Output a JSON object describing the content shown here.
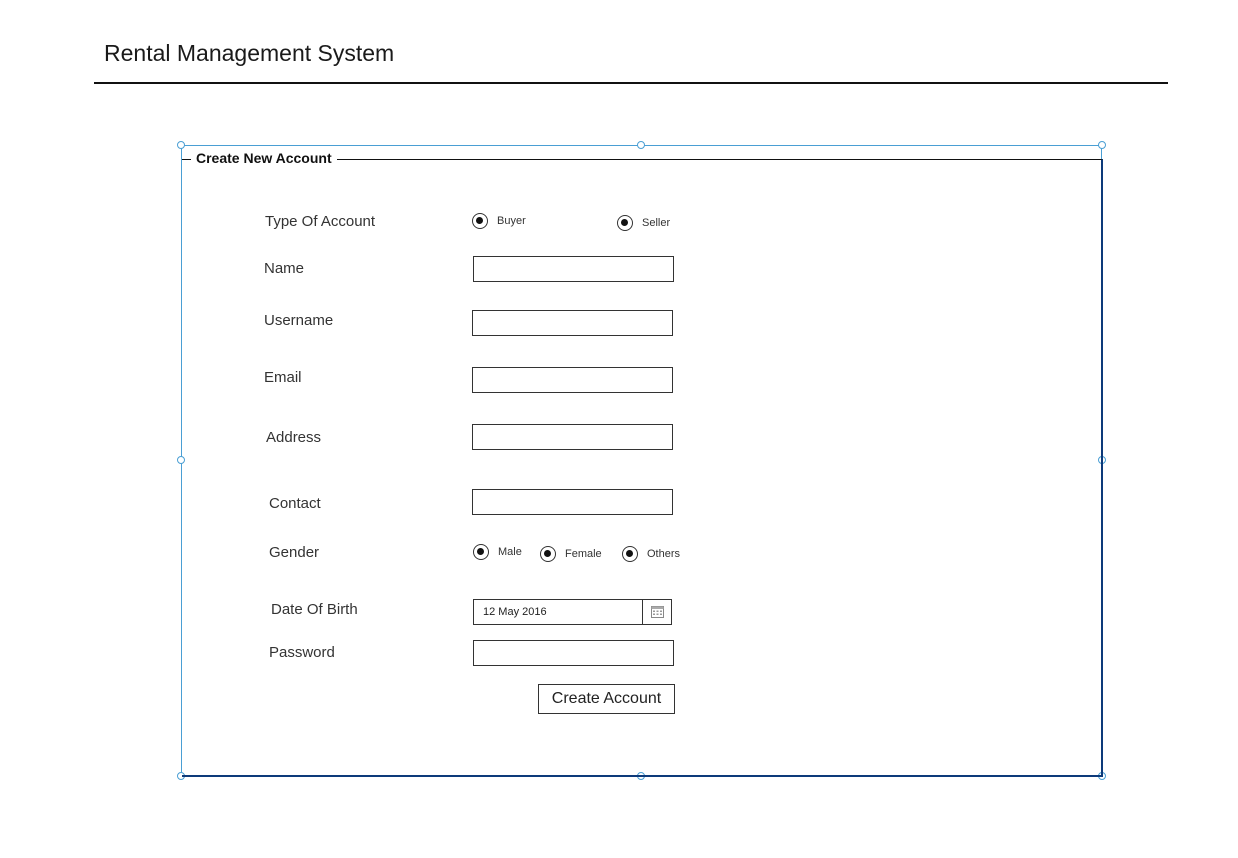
{
  "app": {
    "title": "Rental Management System"
  },
  "form": {
    "legend": "Create New Account",
    "account_type": {
      "label": "Type Of Account",
      "options": [
        "Buyer",
        "Seller"
      ]
    },
    "name": {
      "label": "Name",
      "value": ""
    },
    "username": {
      "label": "Username",
      "value": ""
    },
    "email": {
      "label": "Email",
      "value": ""
    },
    "address": {
      "label": "Address",
      "value": ""
    },
    "contact": {
      "label": "Contact",
      "value": ""
    },
    "gender": {
      "label": "Gender",
      "options": [
        "Male",
        "Female",
        "Others"
      ]
    },
    "dob": {
      "label": "Date Of Birth",
      "value": "12 May 2016",
      "icon": "calendar-icon"
    },
    "password": {
      "label": "Password",
      "value": ""
    },
    "submit_label": "Create Account"
  },
  "colors": {
    "selection": "#4a9fd4",
    "frame_border": "#0d3a7a",
    "text": "#333333"
  }
}
